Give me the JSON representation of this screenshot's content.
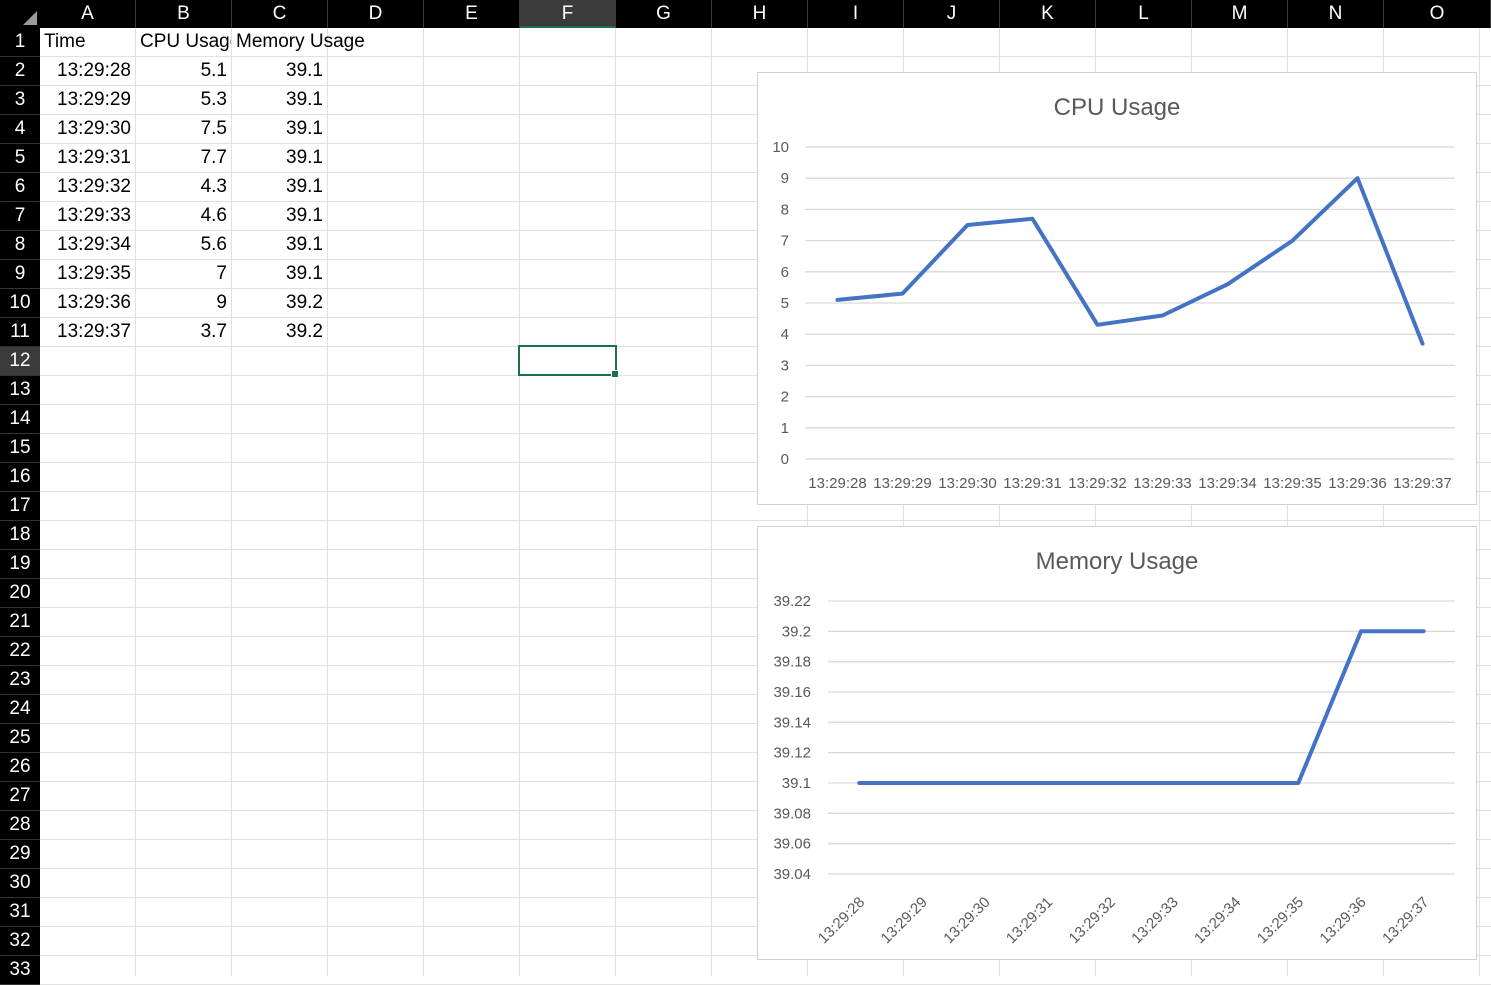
{
  "sheet": {
    "columns": [
      "A",
      "B",
      "C",
      "D",
      "E",
      "F",
      "G",
      "H",
      "I",
      "J",
      "K",
      "L",
      "M",
      "N",
      "O"
    ],
    "rows": [
      "1",
      "2",
      "3",
      "4",
      "5",
      "6",
      "7",
      "8",
      "9",
      "10",
      "11",
      "12",
      "13",
      "14",
      "15",
      "16",
      "17",
      "18",
      "19",
      "20",
      "21",
      "22",
      "23",
      "24",
      "25",
      "26",
      "27",
      "28",
      "29",
      "30",
      "31",
      "32",
      "33"
    ],
    "selected_column": "F",
    "selected_row": "12",
    "headers": {
      "time": "Time",
      "cpu": "CPU Usage",
      "memory": "Memory Usage"
    },
    "data": [
      {
        "time": "13:29:28",
        "cpu": "5.1",
        "memory": "39.1"
      },
      {
        "time": "13:29:29",
        "cpu": "5.3",
        "memory": "39.1"
      },
      {
        "time": "13:29:30",
        "cpu": "7.5",
        "memory": "39.1"
      },
      {
        "time": "13:29:31",
        "cpu": "7.7",
        "memory": "39.1"
      },
      {
        "time": "13:29:32",
        "cpu": "4.3",
        "memory": "39.1"
      },
      {
        "time": "13:29:33",
        "cpu": "4.6",
        "memory": "39.1"
      },
      {
        "time": "13:29:34",
        "cpu": "5.6",
        "memory": "39.1"
      },
      {
        "time": "13:29:35",
        "cpu": "7",
        "memory": "39.1"
      },
      {
        "time": "13:29:36",
        "cpu": "9",
        "memory": "39.2"
      },
      {
        "time": "13:29:37",
        "cpu": "3.7",
        "memory": "39.2"
      }
    ]
  },
  "colors": {
    "line": "#4472c4",
    "grid": "#d9d9d9",
    "axis_text": "#595959",
    "title": "#595959",
    "selection": "#1e7145"
  },
  "chart_data": [
    {
      "type": "line",
      "title": "CPU Usage",
      "categories": [
        "13:29:28",
        "13:29:29",
        "13:29:30",
        "13:29:31",
        "13:29:32",
        "13:29:33",
        "13:29:34",
        "13:29:35",
        "13:29:36",
        "13:29:37"
      ],
      "values": [
        5.1,
        5.3,
        7.5,
        7.7,
        4.3,
        4.6,
        5.6,
        7,
        9,
        3.7
      ],
      "ylim": [
        0,
        10
      ],
      "yticks": [
        "0",
        "1",
        "2",
        "3",
        "4",
        "5",
        "6",
        "7",
        "8",
        "9",
        "10"
      ],
      "grid": true,
      "legend": "none"
    },
    {
      "type": "line",
      "title": "Memory Usage",
      "categories": [
        "13:29:28",
        "13:29:29",
        "13:29:30",
        "13:29:31",
        "13:29:32",
        "13:29:33",
        "13:29:34",
        "13:29:35",
        "13:29:36",
        "13:29:37"
      ],
      "values": [
        39.1,
        39.1,
        39.1,
        39.1,
        39.1,
        39.1,
        39.1,
        39.1,
        39.2,
        39.2
      ],
      "ylim": [
        39.04,
        39.22
      ],
      "yticks": [
        "39.04",
        "39.06",
        "39.08",
        "39.1",
        "39.12",
        "39.14",
        "39.16",
        "39.18",
        "39.2",
        "39.22"
      ],
      "grid": true,
      "legend": "none",
      "x_labels_rotated": true
    }
  ]
}
